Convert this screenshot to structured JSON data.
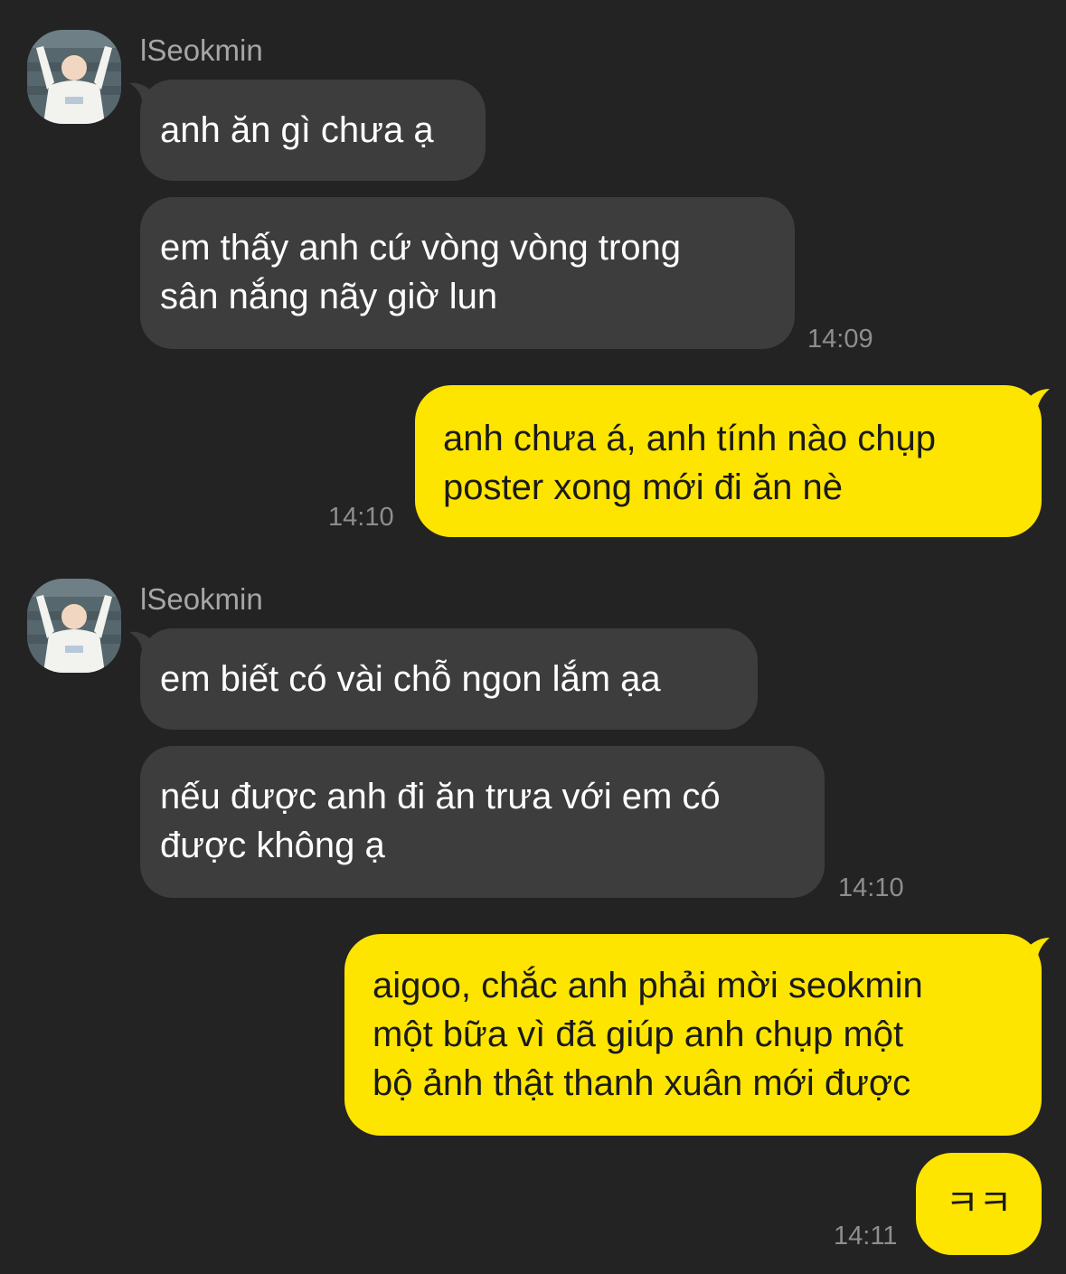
{
  "colors": {
    "background": "#232323",
    "incoming_bubble": "#3d3d3d",
    "outgoing_bubble": "#fee500",
    "timestamp": "#8e8e8e",
    "sender_name": "#a6a6a6"
  },
  "groups": [
    {
      "sender": "lSeokmin",
      "messages": [
        {
          "lines": [
            "anh ăn gì chưa ạ"
          ]
        },
        {
          "lines": [
            "em thấy anh cứ vòng vòng trong",
            "sân nắng nãy giờ lun"
          ],
          "time": "14:09"
        }
      ]
    },
    {
      "outgoing": true,
      "messages": [
        {
          "lines": [
            "anh chưa á, anh tính nào chụp",
            "poster xong mới đi ăn nè"
          ],
          "time": "14:10"
        }
      ]
    },
    {
      "sender": "lSeokmin",
      "messages": [
        {
          "lines": [
            "em biết có vài chỗ ngon lắm ạa"
          ]
        },
        {
          "lines": [
            "nếu được anh đi ăn trưa với em có",
            "được không ạ"
          ],
          "time": "14:10"
        }
      ]
    },
    {
      "outgoing": true,
      "messages": [
        {
          "lines": [
            "aigoo, chắc anh phải mời seokmin",
            "một bữa vì đã giúp anh chụp một",
            "bộ ảnh thật thanh xuân mới được"
          ]
        },
        {
          "lines": [
            "ㅋㅋ"
          ],
          "time": "14:11"
        }
      ]
    }
  ]
}
